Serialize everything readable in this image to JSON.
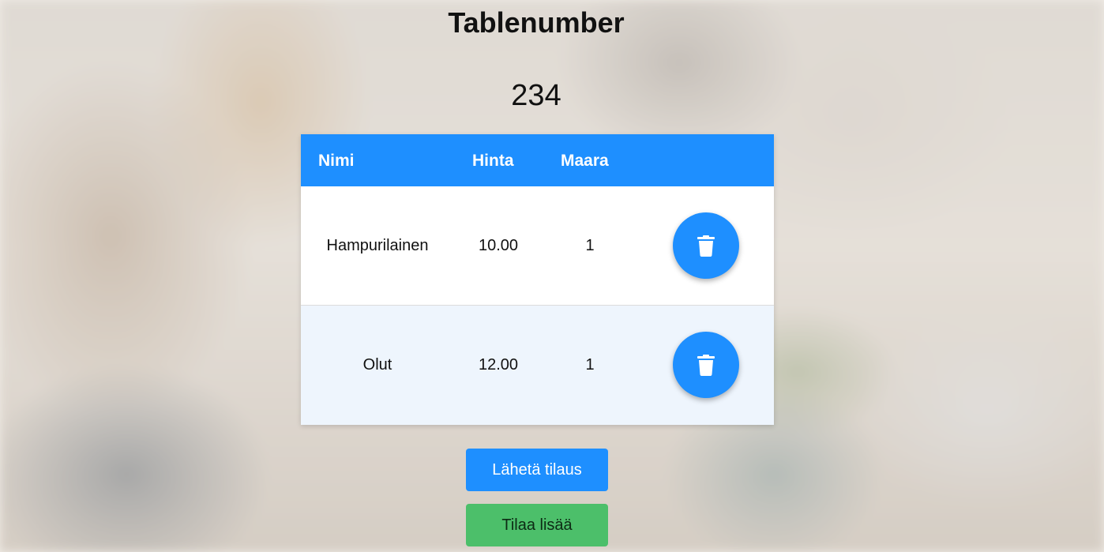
{
  "header": {
    "title": "Tablenumber",
    "table_number": "234"
  },
  "order_table": {
    "columns": {
      "name": "Nimi",
      "price": "Hinta",
      "quantity": "Maara"
    },
    "rows": [
      {
        "name": "Hampurilainen",
        "price": "10.00",
        "quantity": "1",
        "delete_icon": "trash-icon"
      },
      {
        "name": "Olut",
        "price": "12.00",
        "quantity": "1",
        "delete_icon": "trash-icon"
      }
    ]
  },
  "actions": {
    "send_label": "Lähetä tilaus",
    "order_more_label": "Tilaa lisää"
  },
  "colors": {
    "primary": "#1e8fff",
    "success": "#4cbf6a",
    "row_alt": "#eef5fd"
  }
}
